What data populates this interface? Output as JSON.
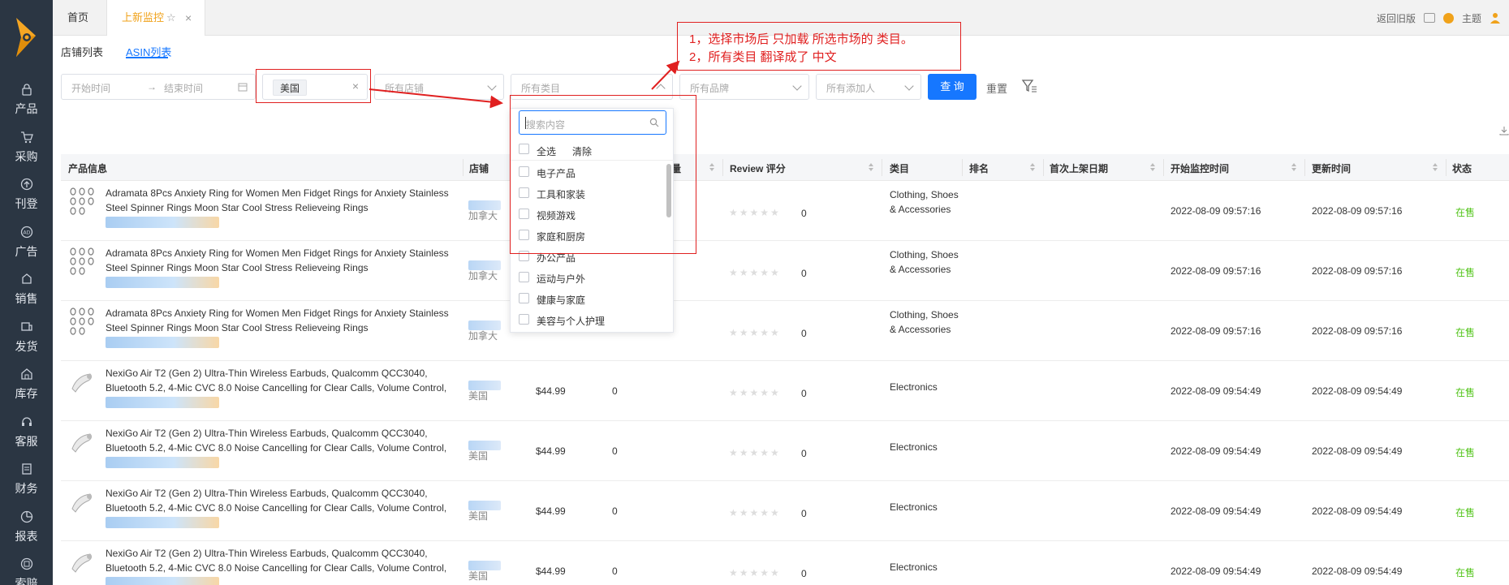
{
  "tabs": {
    "home": "首页",
    "active": "上新监控"
  },
  "top_right": {
    "back_old": "返回旧版",
    "theme": "主题"
  },
  "sidebar": {
    "items": [
      {
        "label": "产品",
        "icon": "lock-icon"
      },
      {
        "label": "采购",
        "icon": "cart-icon"
      },
      {
        "label": "刊登",
        "icon": "upload-icon"
      },
      {
        "label": "广告",
        "icon": "ad-icon"
      },
      {
        "label": "销售",
        "icon": "sales-icon"
      },
      {
        "label": "发货",
        "icon": "truck-icon"
      },
      {
        "label": "库存",
        "icon": "warehouse-icon"
      },
      {
        "label": "客服",
        "icon": "headset-icon"
      },
      {
        "label": "财务",
        "icon": "finance-icon"
      },
      {
        "label": "报表",
        "icon": "chart-icon"
      },
      {
        "label": "索赔",
        "icon": "claim-icon"
      }
    ]
  },
  "subtabs": {
    "store_list": "店铺列表",
    "asin_list": "ASIN列表"
  },
  "filters": {
    "start_time": "开始时间",
    "arrow": "→",
    "end_time": "结束时间",
    "market_tag": "美国",
    "store_ph": "所有店铺",
    "category_ph": "所有类目",
    "brand_ph": "所有品牌",
    "adder_ph": "所有添加人",
    "query": "查 询",
    "reset": "重置"
  },
  "table": {
    "headers": {
      "product": "产品信息",
      "store": "店铺",
      "qty_partial": "量",
      "review": "Review 评分",
      "category": "类目",
      "rank": "排名",
      "first_listed": "首次上架日期",
      "monitor_start": "开始监控时间",
      "updated": "更新时间",
      "status": "状态"
    },
    "rows": [
      {
        "name": "Adramata 8Pcs Anxiety Ring for Women Men Fidget Rings for Anxiety Stainless Steel Spinner Rings Moon Star Cool Stress Relieveing Rings",
        "market": "加拿大",
        "price": "",
        "qty": "",
        "review": "0",
        "category": "Clothing, Shoes & Accessories",
        "monitor_start": "2022-08-09 09:57:16",
        "updated": "2022-08-09 09:57:16",
        "status": "在售"
      },
      {
        "name": "Adramata 8Pcs Anxiety Ring for Women Men Fidget Rings for Anxiety Stainless Steel Spinner Rings Moon Star Cool Stress Relieveing Rings",
        "market": "加拿大",
        "price": "",
        "qty": "",
        "review": "0",
        "category": "Clothing, Shoes & Accessories",
        "monitor_start": "2022-08-09 09:57:16",
        "updated": "2022-08-09 09:57:16",
        "status": "在售"
      },
      {
        "name": "Adramata 8Pcs Anxiety Ring for Women Men Fidget Rings for Anxiety Stainless Steel Spinner Rings Moon Star Cool Stress Relieveing Rings",
        "market": "加拿大",
        "price": "",
        "qty": "",
        "review": "0",
        "category": "Clothing, Shoes & Accessories",
        "monitor_start": "2022-08-09 09:57:16",
        "updated": "2022-08-09 09:57:16",
        "status": "在售"
      },
      {
        "name": "NexiGo Air T2 (Gen 2) Ultra-Thin Wireless Earbuds, Qualcomm QCC3040, Bluetooth 5.2, 4-Mic CVC 8.0 Noise Cancelling for Clear Calls, Volume Control, ...",
        "market": "美国",
        "price": "$44.99",
        "qty": "0",
        "review": "0",
        "category": "Electronics",
        "monitor_start": "2022-08-09 09:54:49",
        "updated": "2022-08-09 09:54:49",
        "status": "在售"
      },
      {
        "name": "NexiGo Air T2 (Gen 2) Ultra-Thin Wireless Earbuds, Qualcomm QCC3040, Bluetooth 5.2, 4-Mic CVC 8.0 Noise Cancelling for Clear Calls, Volume Control, ...",
        "market": "美国",
        "price": "$44.99",
        "qty": "0",
        "review": "0",
        "category": "Electronics",
        "monitor_start": "2022-08-09 09:54:49",
        "updated": "2022-08-09 09:54:49",
        "status": "在售"
      },
      {
        "name": "NexiGo Air T2 (Gen 2) Ultra-Thin Wireless Earbuds, Qualcomm QCC3040, Bluetooth 5.2, 4-Mic CVC 8.0 Noise Cancelling for Clear Calls, Volume Control, ...",
        "market": "美国",
        "price": "$44.99",
        "qty": "0",
        "review": "0",
        "category": "Electronics",
        "monitor_start": "2022-08-09 09:54:49",
        "updated": "2022-08-09 09:54:49",
        "status": "在售"
      },
      {
        "name": "NexiGo Air T2 (Gen 2) Ultra-Thin Wireless Earbuds, Qualcomm QCC3040, Bluetooth 5.2, 4-Mic CVC 8.0 Noise Cancelling for Clear Calls, Volume Control, ...",
        "market": "美国",
        "price": "$44.99",
        "qty": "0",
        "review": "0",
        "category": "Electronics",
        "monitor_start": "2022-08-09 09:54:49",
        "updated": "2022-08-09 09:54:49",
        "status": "在售"
      }
    ]
  },
  "category_dropdown": {
    "search_placeholder": "搜索内容",
    "select_all": "全选",
    "clear": "清除",
    "options": [
      "电子产品",
      "工具和家装",
      "视频游戏",
      "家庭和厨房",
      "办公产品",
      "运动与户外",
      "健康与家庭",
      "美容与个人护理"
    ]
  },
  "annotation": {
    "line1": "1，选择市场后 只加载 所选市场的 类目。",
    "line2": "2，所有类目 翻译成了 中文"
  },
  "colors": {
    "sidebar_bg": "#2b3643",
    "accent": "#1677ff",
    "active_tab": "#f0a21a",
    "status_green": "#52c41a",
    "annotation_red": "#e02020"
  }
}
